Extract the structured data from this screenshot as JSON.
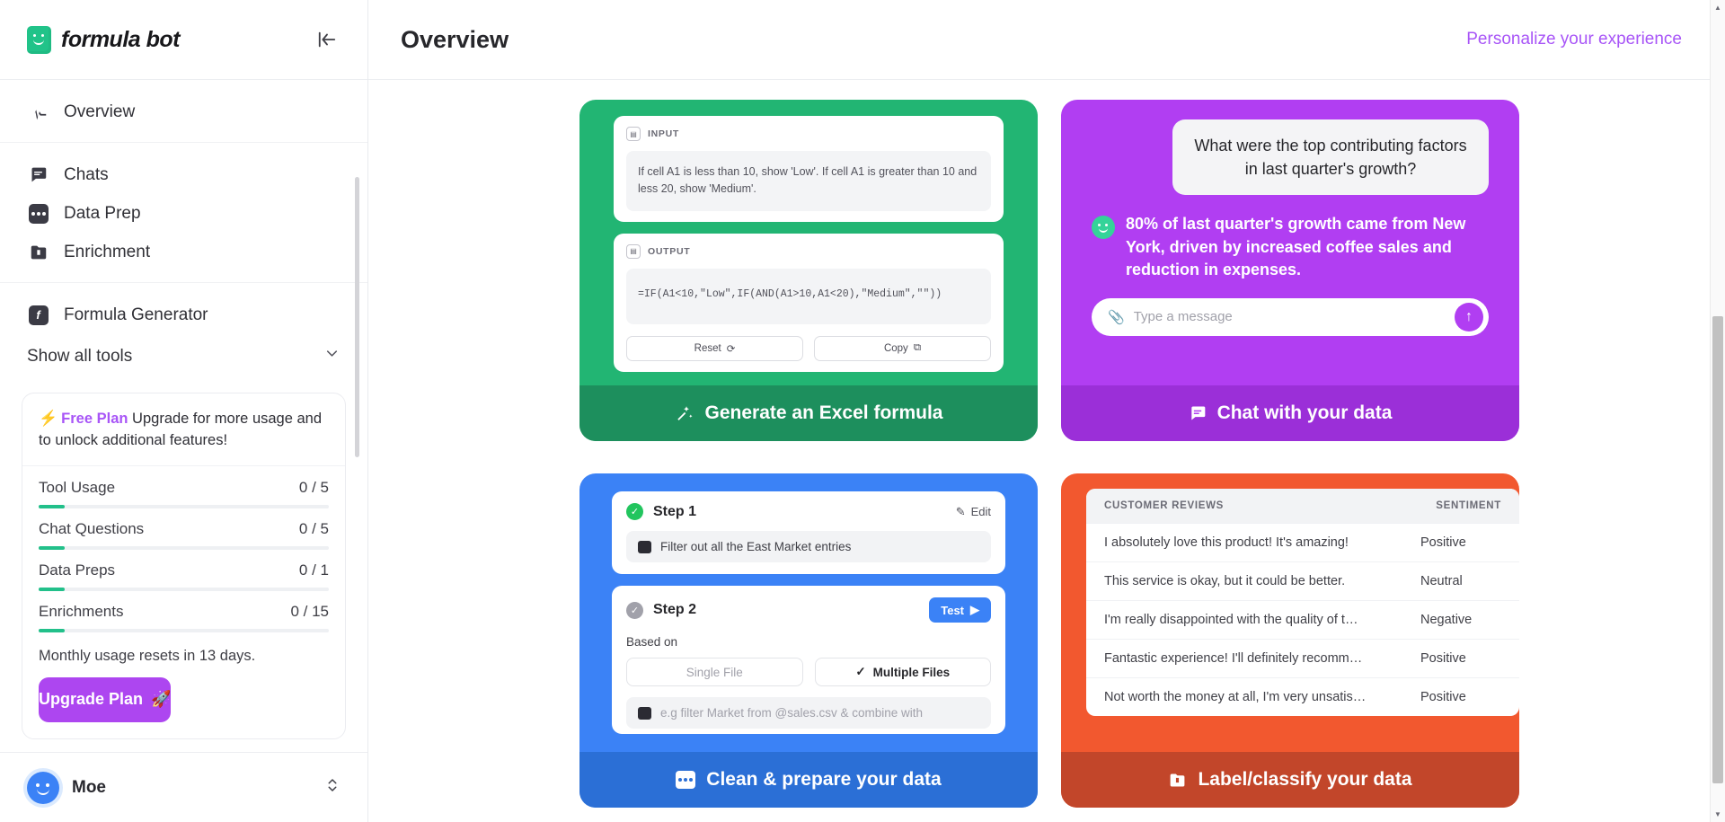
{
  "sidebar": {
    "brand": "formula bot",
    "collapse_label": "collapse-sidebar",
    "nav_primary": [
      {
        "label": "Overview",
        "icon": "overview-icon"
      }
    ],
    "nav_secondary": [
      {
        "label": "Chats",
        "icon": "chat-icon"
      },
      {
        "label": "Data Prep",
        "icon": "data-prep-icon"
      },
      {
        "label": "Enrichment",
        "icon": "enrichment-icon"
      }
    ],
    "nav_tertiary": [
      {
        "label": "Formula Generator",
        "icon": "formula-icon"
      }
    ],
    "show_all_tools": "Show all tools",
    "usage": {
      "plan_name": "Free Plan",
      "plan_desc": " Upgrade for more usage and to unlock additional features!",
      "rows": [
        {
          "label": "Tool Usage",
          "value": "0 / 5",
          "percent": 9
        },
        {
          "label": "Chat Questions",
          "value": "0 / 5",
          "percent": 9
        },
        {
          "label": "Data Preps",
          "value": "0 / 1",
          "percent": 9
        },
        {
          "label": "Enrichments",
          "value": "0 / 15",
          "percent": 9
        }
      ],
      "reset_note": "Monthly usage resets in 13 days.",
      "upgrade_button": "Upgrade Plan",
      "upgrade_icon": "rocket-icon"
    },
    "account": {
      "name": "Moe",
      "avatar": "user-avatar",
      "chevron": "updown-chevron-icon"
    }
  },
  "header": {
    "title": "Overview",
    "personalize": "Personalize your experience"
  },
  "cards": {
    "formula": {
      "footer_label": "Generate an Excel formula",
      "footer_icon": "magic-wand-icon",
      "input_label": "INPUT",
      "input_text": "If cell A1 is less than 10, show 'Low'. If cell A1 is greater than 10 and less 20, show 'Medium'.",
      "output_label": "OUTPUT",
      "output_text": "=IF(A1<10,\"Low\",IF(AND(A1>10,A1<20),\"Medium\",\"\"))",
      "reset_button": "Reset",
      "copy_button": "Copy",
      "accent": "#22b573",
      "footer_accent": "#1d8f5d"
    },
    "chat": {
      "footer_label": "Chat with your data",
      "footer_icon": "chat-bubble-icon",
      "user_message": "What were the top contributing factors in last quarter's growth?",
      "bot_message": "80% of last quarter's growth came from New York, driven by increased coffee sales and reduction in expenses.",
      "input_placeholder": "Type a message",
      "attach_icon": "paperclip-icon",
      "send_icon": "send-arrow-icon",
      "accent": "#b13ef2",
      "footer_accent": "#9b2fd8"
    },
    "dataprep": {
      "footer_label": "Clean & prepare your data",
      "footer_icon": "data-prep-icon",
      "step1_title": "Step 1",
      "step1_edit": "Edit",
      "step1_value": "Filter out all the East Market entries",
      "step2_title": "Step 2",
      "step2_test": "Test",
      "based_on_label": "Based on",
      "option_single": "Single File",
      "option_multiple": "Multiple Files",
      "step2_placeholder": "e.g filter Market from @sales.csv & combine with",
      "accent": "#3b82f6",
      "footer_accent": "#2b6fd6"
    },
    "classify": {
      "footer_label": "Label/classify your data",
      "footer_icon": "enrichment-icon",
      "columns": [
        "CUSTOMER REVIEWS",
        "SENTIMENT"
      ],
      "rows": [
        {
          "review": "I absolutely love this product! It's amazing!",
          "sentiment": "Positive"
        },
        {
          "review": "This service is okay, but it could be better.",
          "sentiment": "Neutral"
        },
        {
          "review": "I'm really disappointed with the quality of t…",
          "sentiment": "Negative"
        },
        {
          "review": "Fantastic experience! I'll definitely recomm…",
          "sentiment": "Positive"
        },
        {
          "review": "Not worth the money at all, I'm very unsatis…",
          "sentiment": "Positive"
        }
      ],
      "accent": "#f2582f",
      "footer_accent": "#c2462a"
    }
  }
}
